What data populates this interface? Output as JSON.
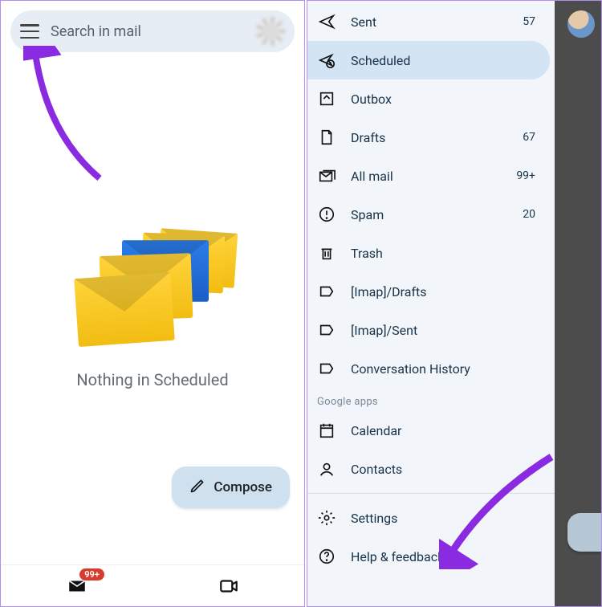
{
  "left": {
    "search_placeholder": "Search in mail",
    "empty_state_text": "Nothing in Scheduled",
    "compose_label": "Compose",
    "mail_badge": "99+"
  },
  "drawer": {
    "items": [
      {
        "icon": "sent-icon",
        "label": "Sent",
        "count": "57",
        "selected": false
      },
      {
        "icon": "scheduled-icon",
        "label": "Scheduled",
        "count": "",
        "selected": true
      },
      {
        "icon": "outbox-icon",
        "label": "Outbox",
        "count": "",
        "selected": false
      },
      {
        "icon": "drafts-icon",
        "label": "Drafts",
        "count": "67",
        "selected": false
      },
      {
        "icon": "allmail-icon",
        "label": "All mail",
        "count": "99+",
        "selected": false
      },
      {
        "icon": "spam-icon",
        "label": "Spam",
        "count": "20",
        "selected": false
      },
      {
        "icon": "trash-icon",
        "label": "Trash",
        "count": "",
        "selected": false
      },
      {
        "icon": "label-icon",
        "label": "[Imap]/Drafts",
        "count": "",
        "selected": false
      },
      {
        "icon": "label-icon",
        "label": "[Imap]/Sent",
        "count": "",
        "selected": false
      },
      {
        "icon": "label-icon",
        "label": "Conversation History",
        "count": "",
        "selected": false
      }
    ],
    "apps_header": "Google apps",
    "apps": [
      {
        "icon": "calendar-icon",
        "label": "Calendar"
      },
      {
        "icon": "contacts-icon",
        "label": "Contacts"
      }
    ],
    "footer": [
      {
        "icon": "settings-icon",
        "label": "Settings"
      },
      {
        "icon": "help-icon",
        "label": "Help & feedback"
      }
    ]
  },
  "colors": {
    "accent": "#8a2be2"
  }
}
